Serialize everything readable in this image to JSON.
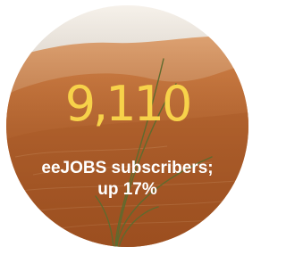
{
  "stat": {
    "value": "9,110",
    "caption_line1": "eeJOBS subscribers;",
    "caption_line2": "up 17%"
  },
  "colors": {
    "number": "#f7d24a",
    "caption": "#ffffff",
    "sand": "#d07a3e",
    "sky": "#f3efe8"
  }
}
